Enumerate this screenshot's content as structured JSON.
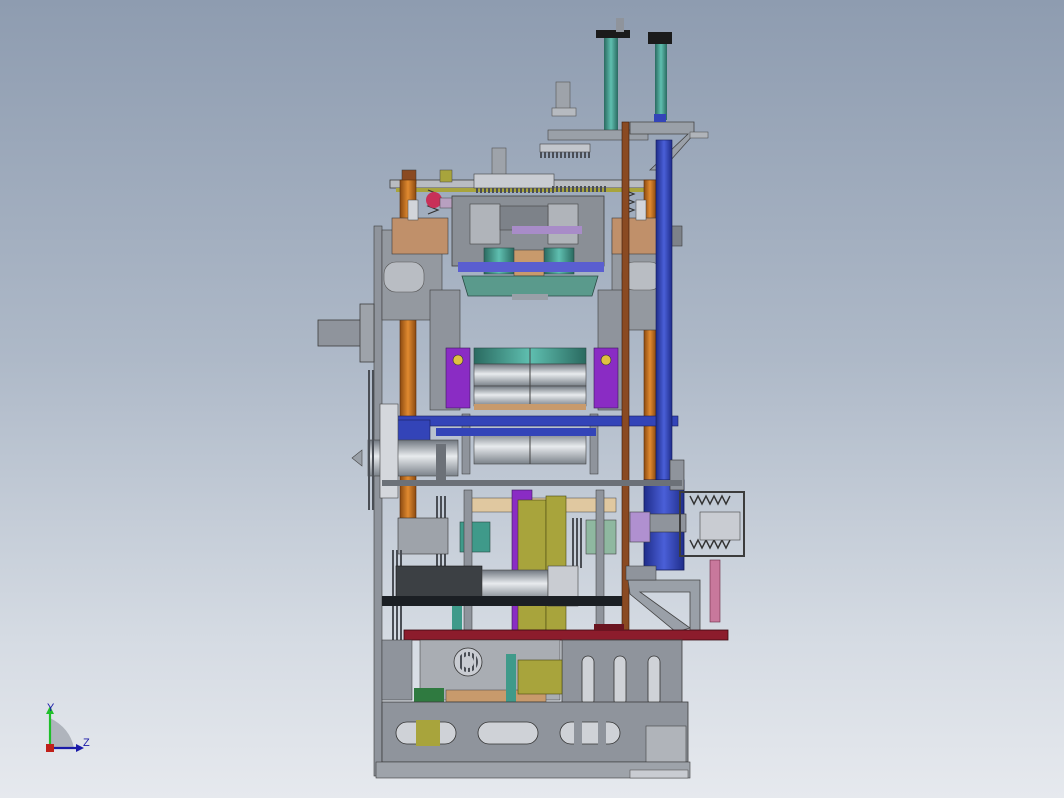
{
  "viewport": {
    "background_top": "#8e9cb0",
    "background_bottom": "#e6e9ee"
  },
  "triad": {
    "y_label": "Y",
    "z_label": "Z",
    "y_color": "#1fbf2a",
    "z_color": "#1a1aa8",
    "x_color": "#c0201a"
  },
  "model": {
    "colors": {
      "frame": "#8f949c",
      "blue": "#3344b8",
      "orange": "#c8701e",
      "teal": "#3f9a8a",
      "purple": "#8a2cc4",
      "maroon": "#8c1c2c",
      "olive": "#a8a43c",
      "brown": "#8a4a22",
      "tan": "#c89a6c",
      "pink": "#c8789c",
      "gray_light": "#c9ccd2",
      "gray_dark": "#5d6168"
    }
  }
}
